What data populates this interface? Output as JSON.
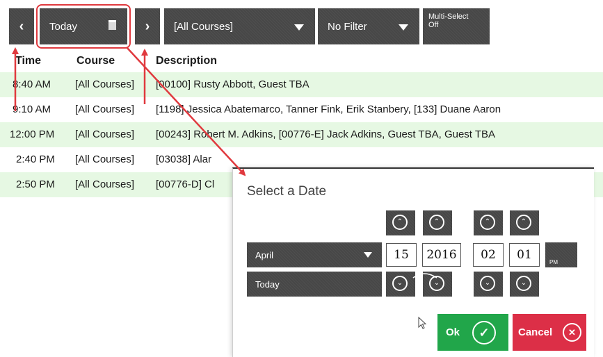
{
  "toolbar": {
    "prev_icon": "‹",
    "date_label": "Today",
    "next_icon": "›",
    "course_select": "[All Courses]",
    "filter_select": "No Filter",
    "multiselect_line1": "Multi-Select",
    "multiselect_line2": "Off"
  },
  "schedule": {
    "headers": {
      "time": "Time",
      "course": "Course",
      "description": "Description"
    },
    "rows": [
      {
        "time": "8:40 AM",
        "course": "[All Courses]",
        "description": "[00100] Rusty Abbott, Guest TBA"
      },
      {
        "time": "9:10 AM",
        "course": "[All Courses]",
        "description": "[1198] Jessica Abatemarco, Tanner Fink, Erik Stanbery, [133] Duane Aaron"
      },
      {
        "time": "12:00 PM",
        "course": "[All Courses]",
        "description": "[00243] Robert M. Adkins, [00776-E] Jack Adkins, Guest TBA, Guest TBA"
      },
      {
        "time": "2:40 PM",
        "course": "[All Courses]",
        "description": "[03038]  Alar"
      },
      {
        "time": "2:50 PM",
        "course": "[All Courses]",
        "description": "[00776-D] Cl"
      }
    ]
  },
  "date_dialog": {
    "title": "Select a Date",
    "month_select": "April",
    "quick_select": "Today",
    "day": "15",
    "year": "2016",
    "hour": "02",
    "minute": "01",
    "ampm": "PM",
    "ok_label": "Ok",
    "cancel_label": "Cancel",
    "up_icon": "⌃",
    "down_icon": "⌄",
    "ok_icon": "✓",
    "cancel_icon": "✕"
  },
  "colors": {
    "dark_button": "#474747",
    "row_green": "#e6f8e3",
    "ok_green": "#21a64a",
    "cancel_red": "#dc2f47",
    "annotation_red": "#e0393e"
  }
}
